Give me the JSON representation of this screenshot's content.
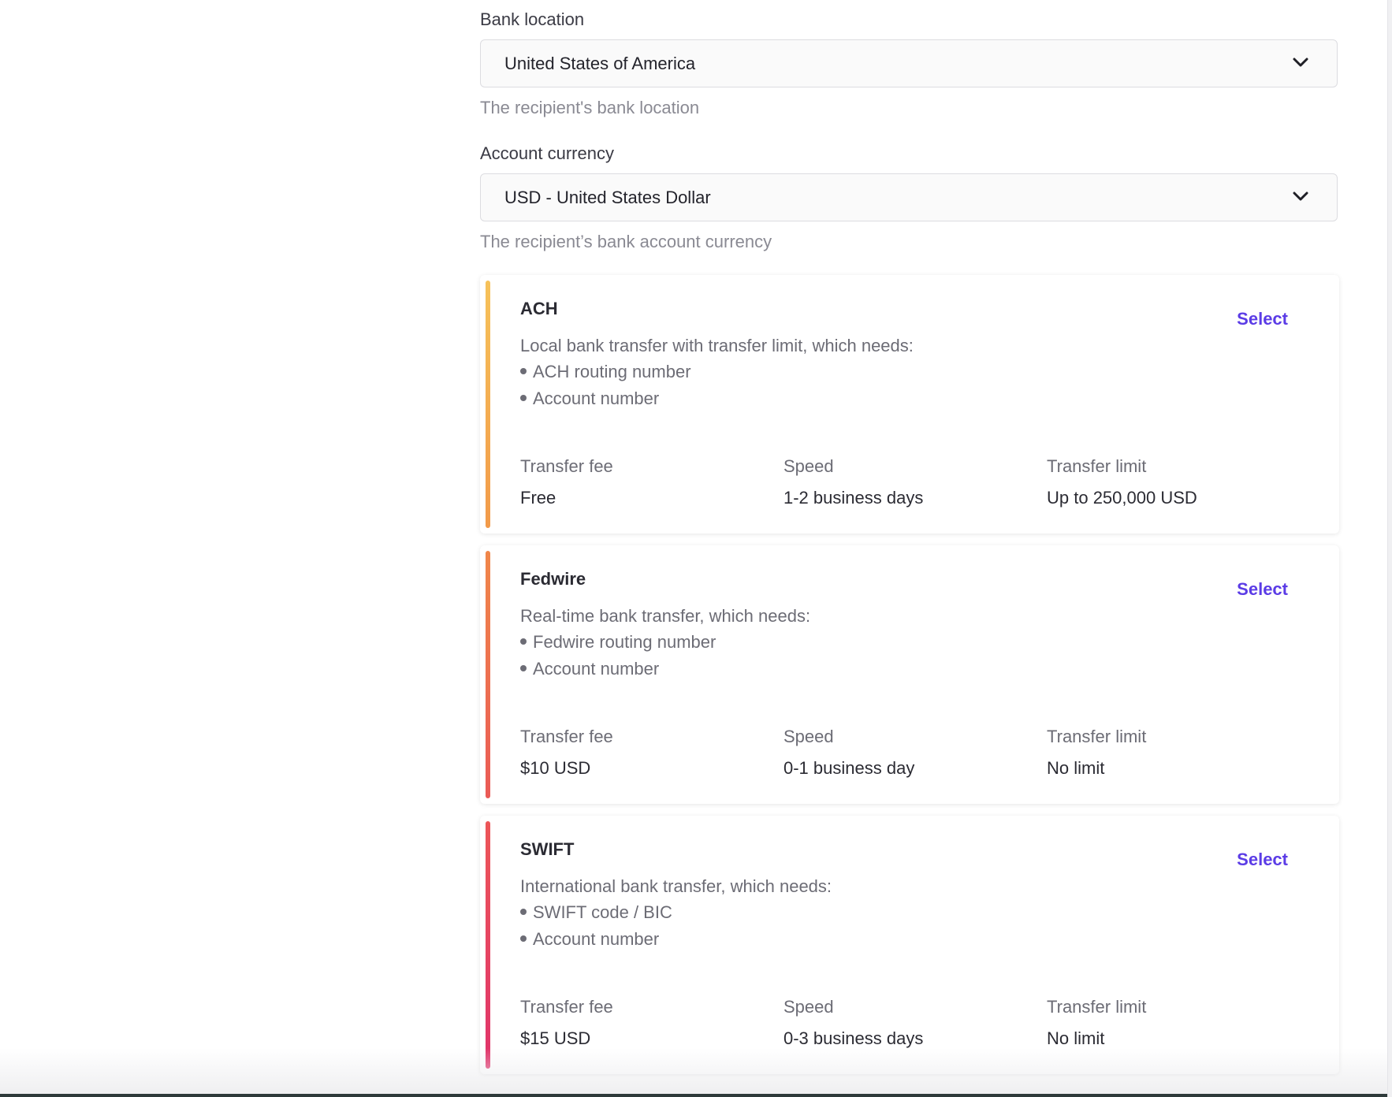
{
  "bank_location": {
    "label": "Bank location",
    "value": "United States of America",
    "help": "The recipient's bank location"
  },
  "account_currency": {
    "label": "Account currency",
    "value": "USD - United States Dollar",
    "help": "The recipient’s bank account currency"
  },
  "icons": {
    "dropdown": "chevron-down-icon",
    "bullet": "bullet-dot"
  },
  "colors": {
    "accent": "#5b3ce6",
    "ach_bar": [
      "#f6c25a",
      "#f29a4a"
    ],
    "fedwire_bar": [
      "#f0874a",
      "#ea5a56"
    ],
    "swift_bar": [
      "#ec5658",
      "#e0336b"
    ]
  },
  "methods": [
    {
      "name": "ACH",
      "select_label": "Select",
      "description": "Local bank transfer with transfer limit, which needs:",
      "requirements": [
        "ACH routing number",
        "Account number"
      ],
      "fee_label": "Transfer fee",
      "fee": "Free",
      "speed_label": "Speed",
      "speed": "1-2 business days",
      "limit_label": "Transfer limit",
      "limit": "Up to 250,000 USD"
    },
    {
      "name": "Fedwire",
      "select_label": "Select",
      "description": "Real-time bank transfer, which needs:",
      "requirements": [
        "Fedwire routing number",
        "Account number"
      ],
      "fee_label": "Transfer fee",
      "fee": "$10 USD",
      "speed_label": "Speed",
      "speed": "0-1 business day",
      "limit_label": "Transfer limit",
      "limit": "No limit"
    },
    {
      "name": "SWIFT",
      "select_label": "Select",
      "description": "International bank transfer, which needs:",
      "requirements": [
        "SWIFT code / BIC",
        "Account number"
      ],
      "fee_label": "Transfer fee",
      "fee": "$15 USD",
      "speed_label": "Speed",
      "speed": "0-3 business days",
      "limit_label": "Transfer limit",
      "limit": "No limit"
    }
  ]
}
